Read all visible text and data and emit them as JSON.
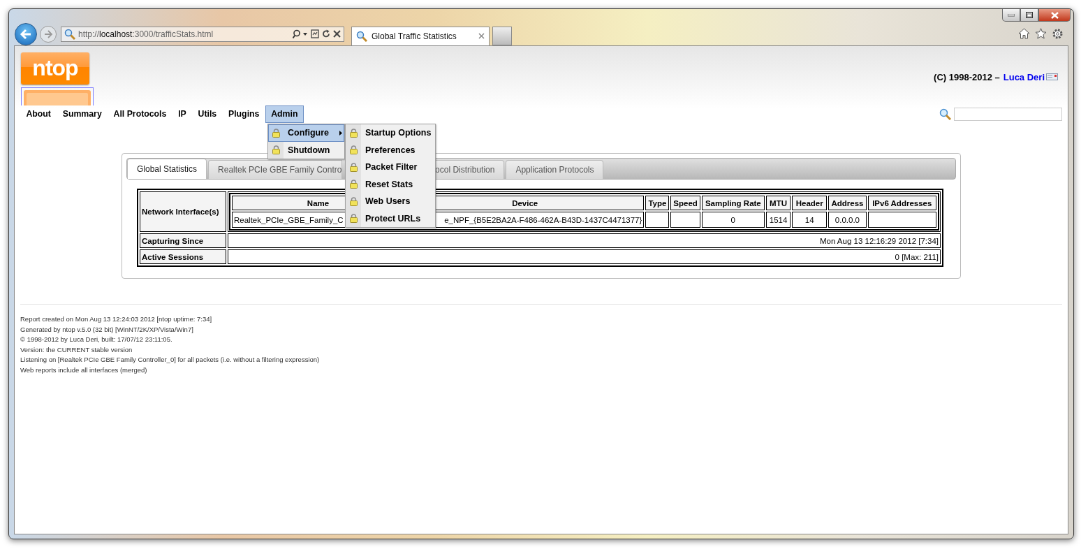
{
  "browser": {
    "url": "http://**localhost**:3000/trafficStats.html",
    "tab_title": "Global Traffic Statistics"
  },
  "header": {
    "logo": "ntop",
    "copyright": "(C) 1998-2012 –",
    "author": "Luca Deri"
  },
  "nav": [
    {
      "label": "About",
      "selected": false
    },
    {
      "label": "Summary",
      "selected": false
    },
    {
      "label": "All Protocols",
      "selected": false
    },
    {
      "label": "IP",
      "selected": false
    },
    {
      "label": "Utils",
      "selected": false
    },
    {
      "label": "Plugins",
      "selected": false
    },
    {
      "label": "Admin",
      "selected": true
    }
  ],
  "admin_menu": [
    {
      "label": "Configure",
      "selected": true,
      "has_submenu": true
    },
    {
      "label": "Shutdown",
      "selected": false,
      "has_submenu": false
    }
  ],
  "configure_submenu": [
    "Startup Options",
    "Preferences",
    "Packet Filter",
    "Reset Stats",
    "Web Users",
    "Protect URLs"
  ],
  "tabs": [
    {
      "label": "Global Statistics",
      "selected": true
    },
    {
      "label": "Realtek PCIe GBE Family Contro",
      "selected": false
    },
    {
      "label": "ocol Distribution",
      "selected": false
    },
    {
      "label": "Application Protocols",
      "selected": false
    }
  ],
  "interfaces": {
    "label": "Network Interface(s)",
    "columns": [
      "Name",
      "Device",
      "Type",
      "Speed",
      "Sampling Rate",
      "MTU",
      "Header",
      "Address",
      "IPv6 Addresses"
    ],
    "rows": [
      [
        "Realtek_PCIe_GBE_Family_C",
        "e_NPF_{B5E2BA2A-F486-462A-B43D-1437C4471377}",
        null,
        null,
        "0",
        "1514",
        "14",
        "0.0.0.0",
        null
      ]
    ]
  },
  "summary_rows": [
    {
      "label": "Capturing Since",
      "value": "Mon Aug 13 12:16:29 2012 [7:34]"
    },
    {
      "label": "Active Sessions",
      "value": "0 [Max: 211]"
    }
  ],
  "footer": [
    "Report created on Mon Aug 13 12:24:03 2012 [ntop uptime: 7:34]",
    "Generated by ntop v.5.0 (32 bit) [WinNT/2K/XP/Vista/Win7]",
    "© 1998-2012 by Luca Deri, built: 17/07/12 23:11:05.",
    "Version: the CURRENT stable version",
    "Listening on [Realtek PCIe GBE Family Controller_0] for all packets (i.e. without a filtering expression)",
    "Web reports include all interfaces (merged)"
  ]
}
